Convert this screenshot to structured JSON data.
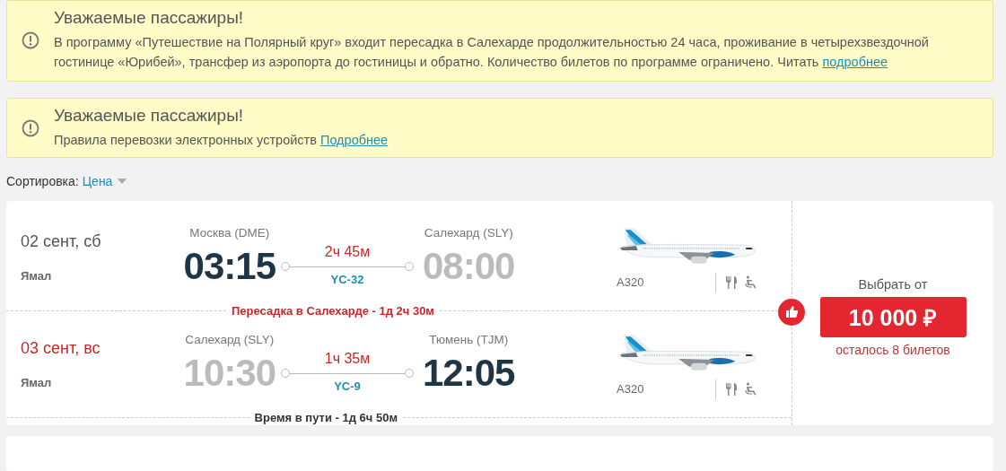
{
  "notices": [
    {
      "title": "Уважаемые пассажиры!",
      "text": "В программу «Путешествие на Полярный круг» входит пересадка в Салехарде продолжительностью 24 часа, проживание в четырехзвездочной гостинице «Юрибей», трансфер из аэропорта до гостиницы и обратно. Количество билетов по программе ограничено. Читать",
      "link": "подробнее"
    },
    {
      "title": "Уважаемые пассажиры!",
      "text": "Правила перевозки электронных устройств",
      "link": "Подробнее"
    }
  ],
  "sort": {
    "label": "Сортировка:",
    "value": "Цена"
  },
  "offer": {
    "segments": [
      {
        "date": "02 сент, сб",
        "date_highlighted": false,
        "airline": "Ямал",
        "departure": {
          "city": "Москва (DME)",
          "time": "03:15",
          "emphasized": true
        },
        "duration": "2ч 45м",
        "flight": "YC-32",
        "arrival": {
          "city": "Салехард (SLY)",
          "time": "08:00",
          "emphasized": false
        },
        "aircraft": "A320"
      },
      {
        "date": "03 сент, вс",
        "date_highlighted": true,
        "airline": "Ямал",
        "departure": {
          "city": "Салехард (SLY)",
          "time": "10:30",
          "emphasized": false
        },
        "duration": "1ч 35м",
        "flight": "YC-9",
        "arrival": {
          "city": "Тюмень (TJM)",
          "time": "12:05",
          "emphasized": true
        },
        "aircraft": "A320"
      }
    ],
    "transfer": "Пересадка в Салехарде - 1д 2ч 30м",
    "total": "Время в пути - 1д 6ч 50м",
    "price_label": "Выбрать от",
    "price": "10 000 ₽",
    "seats_left": "осталось 8 билетов"
  }
}
